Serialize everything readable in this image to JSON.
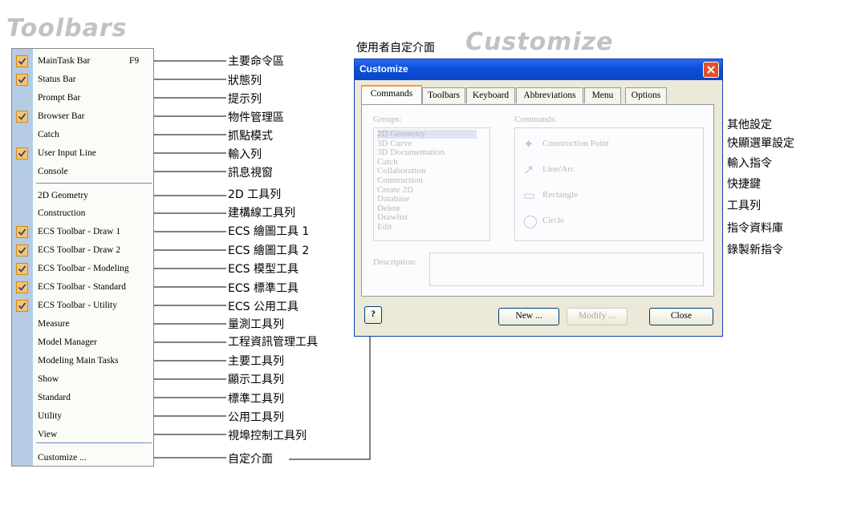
{
  "titles": {
    "toolbars": "Toolbars",
    "customize_cn": "使用者自定介面",
    "customize_en": "Customize"
  },
  "menu": {
    "items": [
      {
        "label": "MainTask Bar",
        "shortcut": "F9",
        "checked": true,
        "cn": "主要命令區"
      },
      {
        "label": "Status Bar",
        "checked": true,
        "cn": "狀態列"
      },
      {
        "label": "Prompt Bar",
        "checked": false,
        "cn": "提示列"
      },
      {
        "label": "Browser Bar",
        "checked": true,
        "cn": "物件管理區"
      },
      {
        "label": "Catch",
        "checked": false,
        "cn": "抓點模式"
      },
      {
        "label": "User Input Line",
        "checked": true,
        "cn": "輸入列"
      },
      {
        "label": "Console",
        "checked": false,
        "cn": "訊息視窗"
      },
      {
        "label": "2D Geometry",
        "checked": false,
        "cn": "2D 工具列"
      },
      {
        "label": "Construction",
        "checked": false,
        "cn": "建構線工具列"
      },
      {
        "label": "ECS Toolbar - Draw 1",
        "checked": true,
        "cn": "ECS 繪圖工具 1"
      },
      {
        "label": "ECS Toolbar - Draw 2",
        "checked": true,
        "cn": "ECS 繪圖工具 2"
      },
      {
        "label": "ECS Toolbar - Modeling",
        "checked": true,
        "cn": "ECS 模型工具"
      },
      {
        "label": "ECS Toolbar - Standard",
        "checked": true,
        "cn": "ECS 標準工具"
      },
      {
        "label": "ECS Toolbar - Utility",
        "checked": true,
        "cn": "ECS 公用工具"
      },
      {
        "label": "Measure",
        "checked": false,
        "cn": "量測工具列"
      },
      {
        "label": "Model Manager",
        "checked": false,
        "cn": "工程資訊管理工具"
      },
      {
        "label": "Modeling Main Tasks",
        "checked": false,
        "cn": "主要工具列"
      },
      {
        "label": "Show",
        "checked": false,
        "cn": "顯示工具列"
      },
      {
        "label": "Standard",
        "checked": false,
        "cn": "標準工具列"
      },
      {
        "label": "Utility",
        "checked": false,
        "cn": "公用工具列"
      },
      {
        "label": "View",
        "checked": false,
        "cn": "視埠控制工具列"
      },
      {
        "label": "Customize ...",
        "checked": false,
        "cn": "自定介面"
      }
    ]
  },
  "dialog": {
    "title": "Customize",
    "tabs": [
      "Commands",
      "Toolbars",
      "Keyboard",
      "Abbreviations",
      "Menu",
      "Options"
    ],
    "groups_label": "Groups:",
    "groups": [
      "2D Geometry",
      "3D Curve",
      "3D Documentation",
      "Catch",
      "Collaboration",
      "Construction",
      "Create 2D",
      "Database",
      "Delete",
      "Drawlist",
      "Edit"
    ],
    "commands_label": "Commands:",
    "commands": [
      "Construction Point",
      "Line/Arc",
      "Rectangle",
      "Circle"
    ],
    "description_label": "Description:",
    "help_glyph": "?",
    "buttons": {
      "new": "New ...",
      "modify": "Modify ...",
      "close": "Close"
    }
  },
  "dialog_callouts": [
    "其他設定",
    "快顯選單設定",
    "輸入指令",
    "快捷鍵",
    "工具列",
    "指令資料庫",
    "錄製新指令"
  ],
  "colors": {
    "check_fill": "#f7c46a",
    "menu_strip": "#b6cbe4",
    "title_bar": "#0a4fd8",
    "dialog_bg": "#ece9d8"
  }
}
